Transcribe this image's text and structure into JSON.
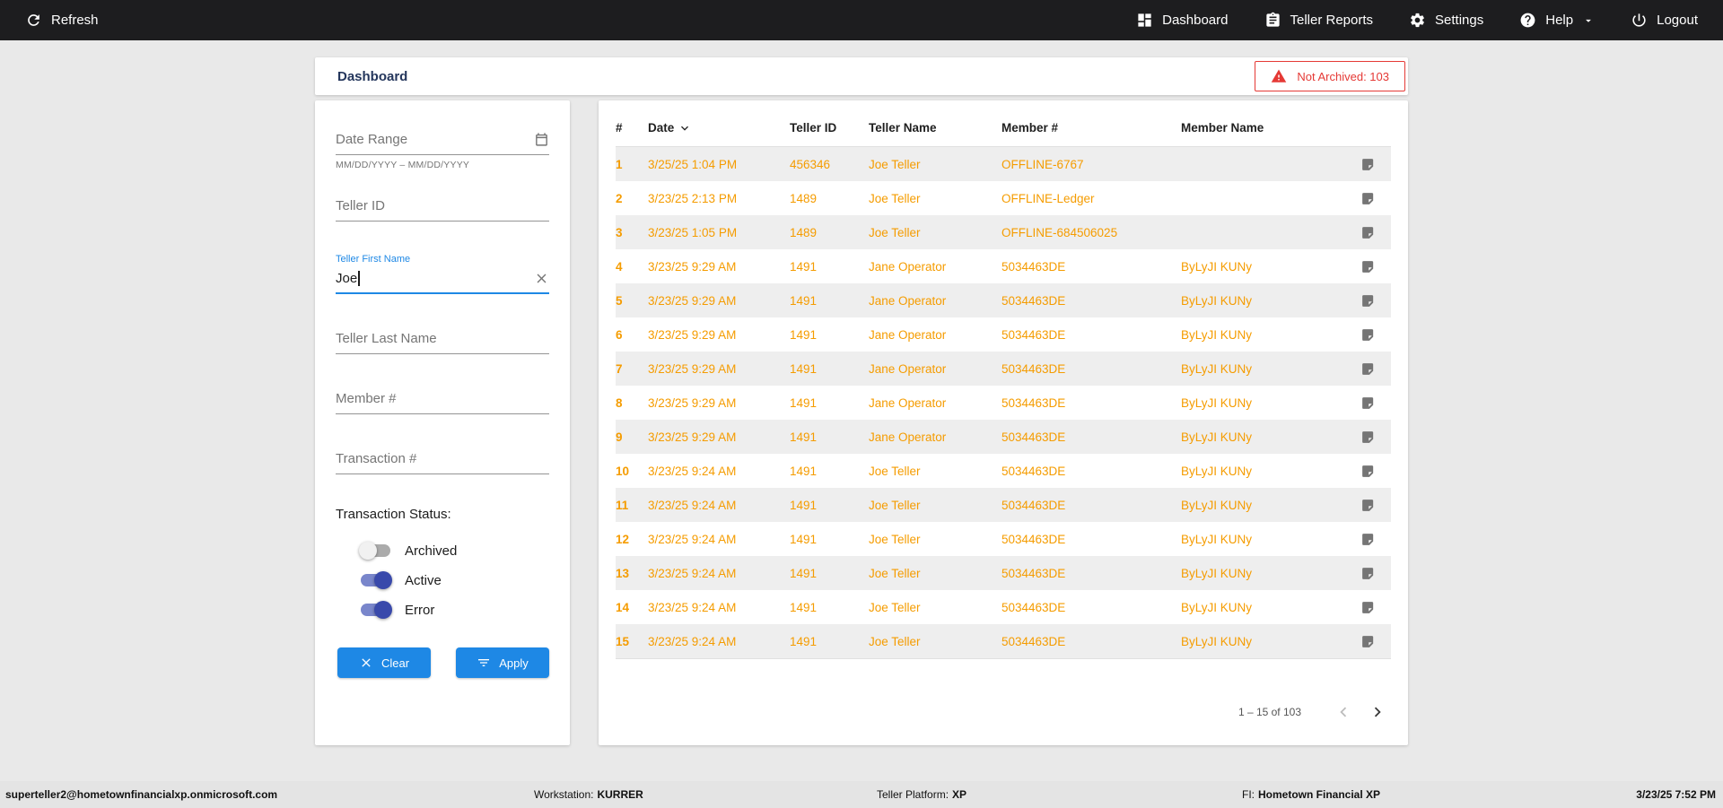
{
  "topbar": {
    "refresh_label": "Refresh",
    "nav": [
      {
        "label": "Dashboard",
        "icon": "dashboard-icon"
      },
      {
        "label": "Teller Reports",
        "icon": "reports-icon"
      },
      {
        "label": "Settings",
        "icon": "settings-icon"
      },
      {
        "label": "Help",
        "icon": "help-icon",
        "has_caret": true
      },
      {
        "label": "Logout",
        "icon": "logout-icon"
      }
    ]
  },
  "header": {
    "title": "Dashboard",
    "not_archived_badge": "Not Archived: 103"
  },
  "filters": {
    "date_range": {
      "placeholder": "Date Range",
      "value": "",
      "hint": "MM/DD/YYYY – MM/DD/YYYY"
    },
    "teller_id": {
      "placeholder": "Teller ID",
      "value": ""
    },
    "teller_first_name": {
      "label": "Teller First Name",
      "value": "Joe"
    },
    "teller_last_name": {
      "placeholder": "Teller Last Name",
      "value": ""
    },
    "member_number": {
      "placeholder": "Member #",
      "value": ""
    },
    "transaction_number": {
      "placeholder": "Transaction #",
      "value": ""
    },
    "status_label": "Transaction Status:",
    "toggles": [
      {
        "label": "Archived",
        "on": false
      },
      {
        "label": "Active",
        "on": true
      },
      {
        "label": "Error",
        "on": true
      }
    ],
    "clear_label": "Clear",
    "apply_label": "Apply"
  },
  "table": {
    "columns": [
      "#",
      "Date",
      "Teller ID",
      "Teller Name",
      "Member #",
      "Member Name"
    ],
    "sorted_by": "Date",
    "rows": [
      {
        "num": "1",
        "date": "3/25/25 1:04 PM",
        "teller_id": "456346",
        "teller_name": "Joe Teller",
        "member": "OFFLINE-6767",
        "member_name": ""
      },
      {
        "num": "2",
        "date": "3/23/25 2:13 PM",
        "teller_id": "1489",
        "teller_name": "Joe Teller",
        "member": "OFFLINE-Ledger",
        "member_name": ""
      },
      {
        "num": "3",
        "date": "3/23/25 1:05 PM",
        "teller_id": "1489",
        "teller_name": "Joe Teller",
        "member": "OFFLINE-684506025",
        "member_name": ""
      },
      {
        "num": "4",
        "date": "3/23/25 9:29 AM",
        "teller_id": "1491",
        "teller_name": "Jane Operator",
        "member": "5034463DE",
        "member_name": "ByLyJI KUNy"
      },
      {
        "num": "5",
        "date": "3/23/25 9:29 AM",
        "teller_id": "1491",
        "teller_name": "Jane Operator",
        "member": "5034463DE",
        "member_name": "ByLyJI KUNy"
      },
      {
        "num": "6",
        "date": "3/23/25 9:29 AM",
        "teller_id": "1491",
        "teller_name": "Jane Operator",
        "member": "5034463DE",
        "member_name": "ByLyJI KUNy"
      },
      {
        "num": "7",
        "date": "3/23/25 9:29 AM",
        "teller_id": "1491",
        "teller_name": "Jane Operator",
        "member": "5034463DE",
        "member_name": "ByLyJI KUNy"
      },
      {
        "num": "8",
        "date": "3/23/25 9:29 AM",
        "teller_id": "1491",
        "teller_name": "Jane Operator",
        "member": "5034463DE",
        "member_name": "ByLyJI KUNy"
      },
      {
        "num": "9",
        "date": "3/23/25 9:29 AM",
        "teller_id": "1491",
        "teller_name": "Jane Operator",
        "member": "5034463DE",
        "member_name": "ByLyJI KUNy"
      },
      {
        "num": "10",
        "date": "3/23/25 9:24 AM",
        "teller_id": "1491",
        "teller_name": "Joe Teller",
        "member": "5034463DE",
        "member_name": "ByLyJI KUNy"
      },
      {
        "num": "11",
        "date": "3/23/25 9:24 AM",
        "teller_id": "1491",
        "teller_name": "Joe Teller",
        "member": "5034463DE",
        "member_name": "ByLyJI KUNy"
      },
      {
        "num": "12",
        "date": "3/23/25 9:24 AM",
        "teller_id": "1491",
        "teller_name": "Joe Teller",
        "member": "5034463DE",
        "member_name": "ByLyJI KUNy"
      },
      {
        "num": "13",
        "date": "3/23/25 9:24 AM",
        "teller_id": "1491",
        "teller_name": "Joe Teller",
        "member": "5034463DE",
        "member_name": "ByLyJI KUNy"
      },
      {
        "num": "14",
        "date": "3/23/25 9:24 AM",
        "teller_id": "1491",
        "teller_name": "Joe Teller",
        "member": "5034463DE",
        "member_name": "ByLyJI KUNy"
      },
      {
        "num": "15",
        "date": "3/23/25 9:24 AM",
        "teller_id": "1491",
        "teller_name": "Joe Teller",
        "member": "5034463DE",
        "member_name": "ByLyJI KUNy"
      }
    ],
    "pagination": {
      "range": "1 – 15 of 103"
    }
  },
  "footer": {
    "user": "superteller2@hometownfinancialxp.onmicrosoft.com",
    "workstation_label": "Workstation:",
    "workstation": "KURRER",
    "platform_label": "Teller Platform:",
    "platform": "XP",
    "fi_label": "FI:",
    "fi": "Hometown Financial XP",
    "datetime": "3/23/25 7:52 PM"
  },
  "colors": {
    "topbar_bg": "#1D1D1F",
    "accent_blue": "#1E88E5",
    "row_orange": "#F59C00",
    "alert_red": "#E53935",
    "toggle_on": "#3949AB",
    "title_navy": "#24365C"
  }
}
